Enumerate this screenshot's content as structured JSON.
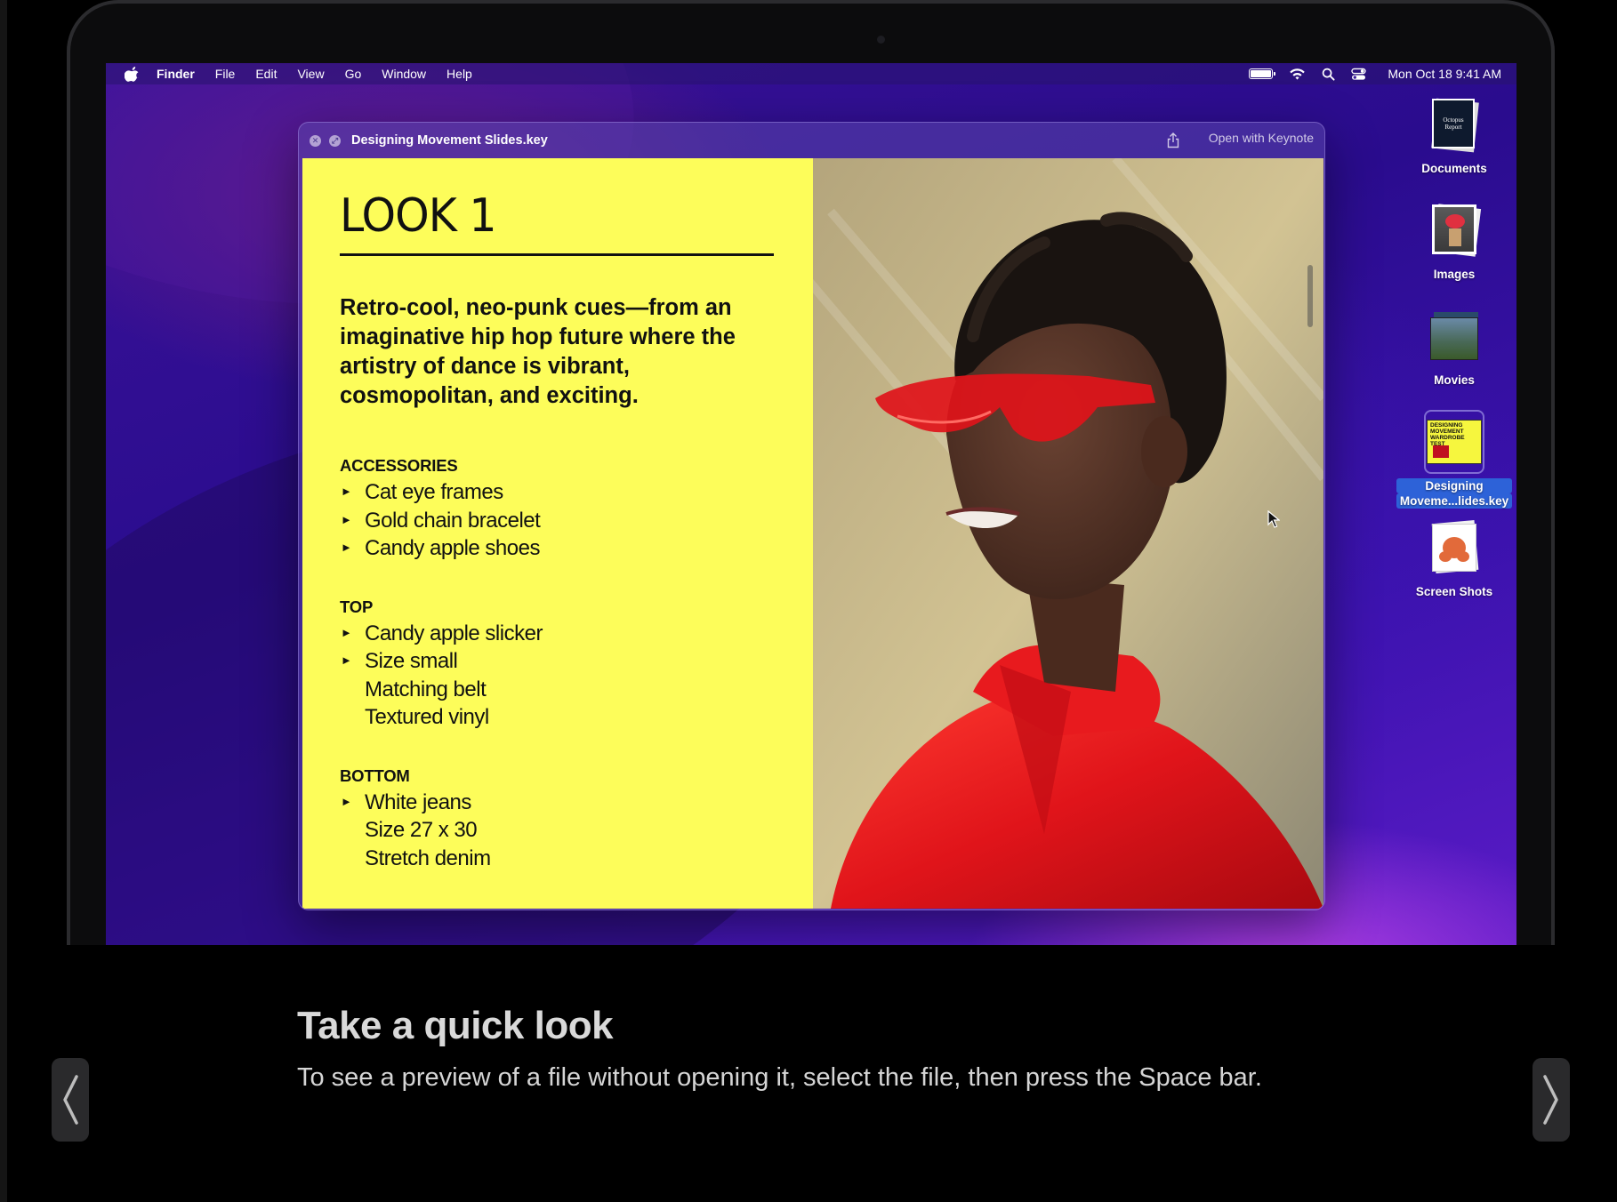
{
  "menubar": {
    "apple_icon": "apple-icon",
    "items": [
      "Finder",
      "File",
      "Edit",
      "View",
      "Go",
      "Window",
      "Help"
    ],
    "status_icons": [
      "battery-icon",
      "wifi-icon",
      "search-icon",
      "control-center-icon"
    ],
    "clock": "Mon Oct 18  9:41 AM"
  },
  "quicklook": {
    "title": "Designing Movement Slides.key",
    "open_with": "Open with Keynote",
    "slide": {
      "heading": "LOOK 1",
      "lede": "Retro-cool, neo-punk cues—from an imaginative hip hop future where the artistry of dance is vibrant, cosmopolitan, and exciting.",
      "sections": [
        {
          "label": "ACCESSORIES",
          "items": [
            {
              "text": "Cat eye frames",
              "bullet": true
            },
            {
              "text": "Gold chain bracelet",
              "bullet": true
            },
            {
              "text": "Candy apple shoes",
              "bullet": true
            }
          ]
        },
        {
          "label": "TOP",
          "items": [
            {
              "text": "Candy apple slicker",
              "bullet": true
            },
            {
              "text": "Size small",
              "bullet": true
            },
            {
              "text": "Matching belt",
              "bullet": false
            },
            {
              "text": "Textured vinyl",
              "bullet": false
            }
          ]
        },
        {
          "label": "BOTTOM",
          "items": [
            {
              "text": "White jeans",
              "bullet": true
            },
            {
              "text": "Size 27 x 30",
              "bullet": false
            },
            {
              "text": "Stretch denim",
              "bullet": false
            }
          ]
        }
      ],
      "bullet_glyph": "►"
    }
  },
  "desktop": {
    "icons": [
      {
        "label": "Documents"
      },
      {
        "label": "Images"
      },
      {
        "label": "Movies"
      },
      {
        "label": "Designing\nMoveme...lides.key",
        "line1": "Designing",
        "line2": "Moveme...lides.key",
        "selected": true
      },
      {
        "label": "Screen Shots"
      }
    ],
    "doc_thumb_text": "Octopus Report",
    "key_thumb_text": "DESIGNING MOVEMENT WARDROBE TEST"
  },
  "caption": {
    "title": "Take a quick look",
    "text": "To see a preview of a file without opening it, select the file, then press the Space bar."
  },
  "nav": {
    "prev_glyph": "❬",
    "next_glyph": "❭"
  },
  "colors": {
    "slide_yellow": "#fdfd5a",
    "selection_blue": "#2d62d8",
    "wallpaper_purple": "#3a1298"
  }
}
